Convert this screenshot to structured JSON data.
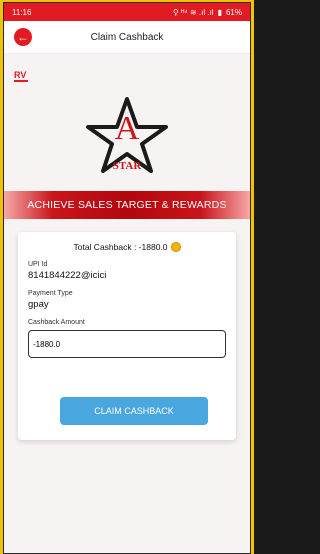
{
  "status": {
    "time": "11:16",
    "indicators": "⚲ ᴴ⁴ ≋ .ıl .ıl",
    "battery": "61%"
  },
  "header": {
    "title": "Claim Cashback"
  },
  "logo": {
    "brand_letter": "A",
    "brand_name": "STAR",
    "rv_text": "RV"
  },
  "banner": {
    "text": "ACHIEVE SALES TARGET & REWARDS"
  },
  "card": {
    "total_label": "Total Cashback : -1880.0",
    "upi_label": "UPI Id",
    "upi_value": "8141844222@icici",
    "payment_label": "Payment Type",
    "payment_value": "gpay",
    "amount_label": "Cashback Amount",
    "amount_value": "-1880.0",
    "button_label": "CLAIM CASHBACK"
  },
  "colors": {
    "primary": "#e21b22",
    "button": "#4aa6de",
    "frame": "#f2c200"
  }
}
